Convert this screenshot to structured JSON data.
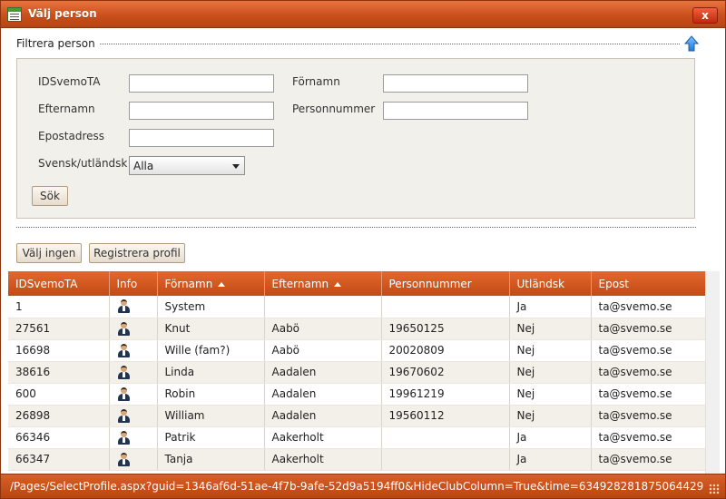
{
  "window": {
    "title": "Välj person",
    "close_label": "x"
  },
  "filter": {
    "legend": "Filtrera person",
    "fields": {
      "idsvemota": {
        "label": "IDSvemoTA",
        "value": ""
      },
      "fornamn": {
        "label": "Förnamn",
        "value": ""
      },
      "efternamn": {
        "label": "Efternamn",
        "value": ""
      },
      "personnummer": {
        "label": "Personnummer",
        "value": ""
      },
      "epostadress": {
        "label": "Epostadress",
        "value": ""
      },
      "svensk_utlandsk": {
        "label": "Svensk/utländsk",
        "selected": "Alla"
      }
    },
    "search_button": "Sök"
  },
  "actions": {
    "valj_ingen": "Välj ingen",
    "registrera_profil": "Registrera profil"
  },
  "table": {
    "columns": [
      "IDSvemoTA",
      "Info",
      "Förnamn",
      "Efternamn",
      "Personnummer",
      "Utländsk",
      "Epost"
    ],
    "sorted_columns": [
      "Förnamn",
      "Efternamn"
    ],
    "rows": [
      {
        "id": "1",
        "fornamn": "System",
        "efternamn": "",
        "personnummer": "",
        "utlandsk": "Ja",
        "epost": "ta@svemo.se"
      },
      {
        "id": "27561",
        "fornamn": "Knut",
        "efternamn": "Aabö",
        "personnummer": "19650125",
        "utlandsk": "Nej",
        "epost": "ta@svemo.se"
      },
      {
        "id": "16698",
        "fornamn": "Wille (fam?)",
        "efternamn": "Aabö",
        "personnummer": "20020809",
        "utlandsk": "Nej",
        "epost": "ta@svemo.se"
      },
      {
        "id": "38616",
        "fornamn": "Linda",
        "efternamn": "Aadalen",
        "personnummer": "19670602",
        "utlandsk": "Nej",
        "epost": "ta@svemo.se"
      },
      {
        "id": "600",
        "fornamn": "Robin",
        "efternamn": "Aadalen",
        "personnummer": "19961219",
        "utlandsk": "Nej",
        "epost": "ta@svemo.se"
      },
      {
        "id": "26898",
        "fornamn": "William",
        "efternamn": "Aadalen",
        "personnummer": "19560112",
        "utlandsk": "Nej",
        "epost": "ta@svemo.se"
      },
      {
        "id": "66346",
        "fornamn": "Patrik",
        "efternamn": "Aakerholt",
        "personnummer": "",
        "utlandsk": "Ja",
        "epost": "ta@svemo.se"
      },
      {
        "id": "66347",
        "fornamn": "Tanja",
        "efternamn": "Aakerholt",
        "personnummer": "",
        "utlandsk": "Ja",
        "epost": "ta@svemo.se"
      }
    ]
  },
  "status": {
    "url": "/Pages/SelectProfile.aspx?guid=1346af6d-51ae-4f7b-9afe-52d9a5194ff0&HideClubColumn=True&time=634928281875064429"
  },
  "icons": {
    "app": "list-window-icon",
    "collapse": "arrow-up-icon",
    "info": "person-icon"
  },
  "colors": {
    "accent": "#c9501c",
    "header": "#d85a22",
    "row_alt": "#f3f0e9"
  }
}
